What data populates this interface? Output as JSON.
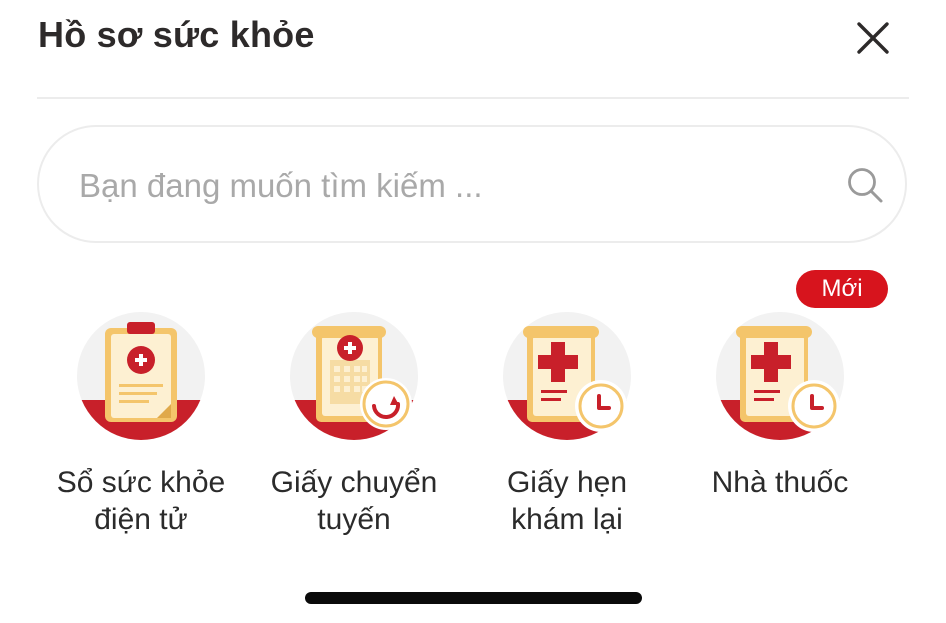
{
  "header": {
    "title": "Hồ sơ sức khỏe",
    "close_icon": "close-icon"
  },
  "search": {
    "placeholder": "Bạn đang muốn tìm kiếm ...",
    "value": "",
    "icon": "search-icon"
  },
  "tiles": [
    {
      "label": "Sổ sức khỏe\nđiện tử",
      "icon": "clipboard-medical-icon"
    },
    {
      "label": "Giấy chuyển\ntuyến",
      "icon": "hospital-transfer-icon"
    },
    {
      "label": "Giấy hẹn\nkhám lại",
      "icon": "appointment-document-icon"
    },
    {
      "label": "Nhà thuốc",
      "icon": "pharmacy-document-icon",
      "badge": "Mới"
    }
  ],
  "colors": {
    "accent_red": "#d7141d",
    "icon_gold": "#f4c56b",
    "icon_cream": "#fdf0d2",
    "icon_bg": "#f2f2f2",
    "divider": "#ececec"
  }
}
